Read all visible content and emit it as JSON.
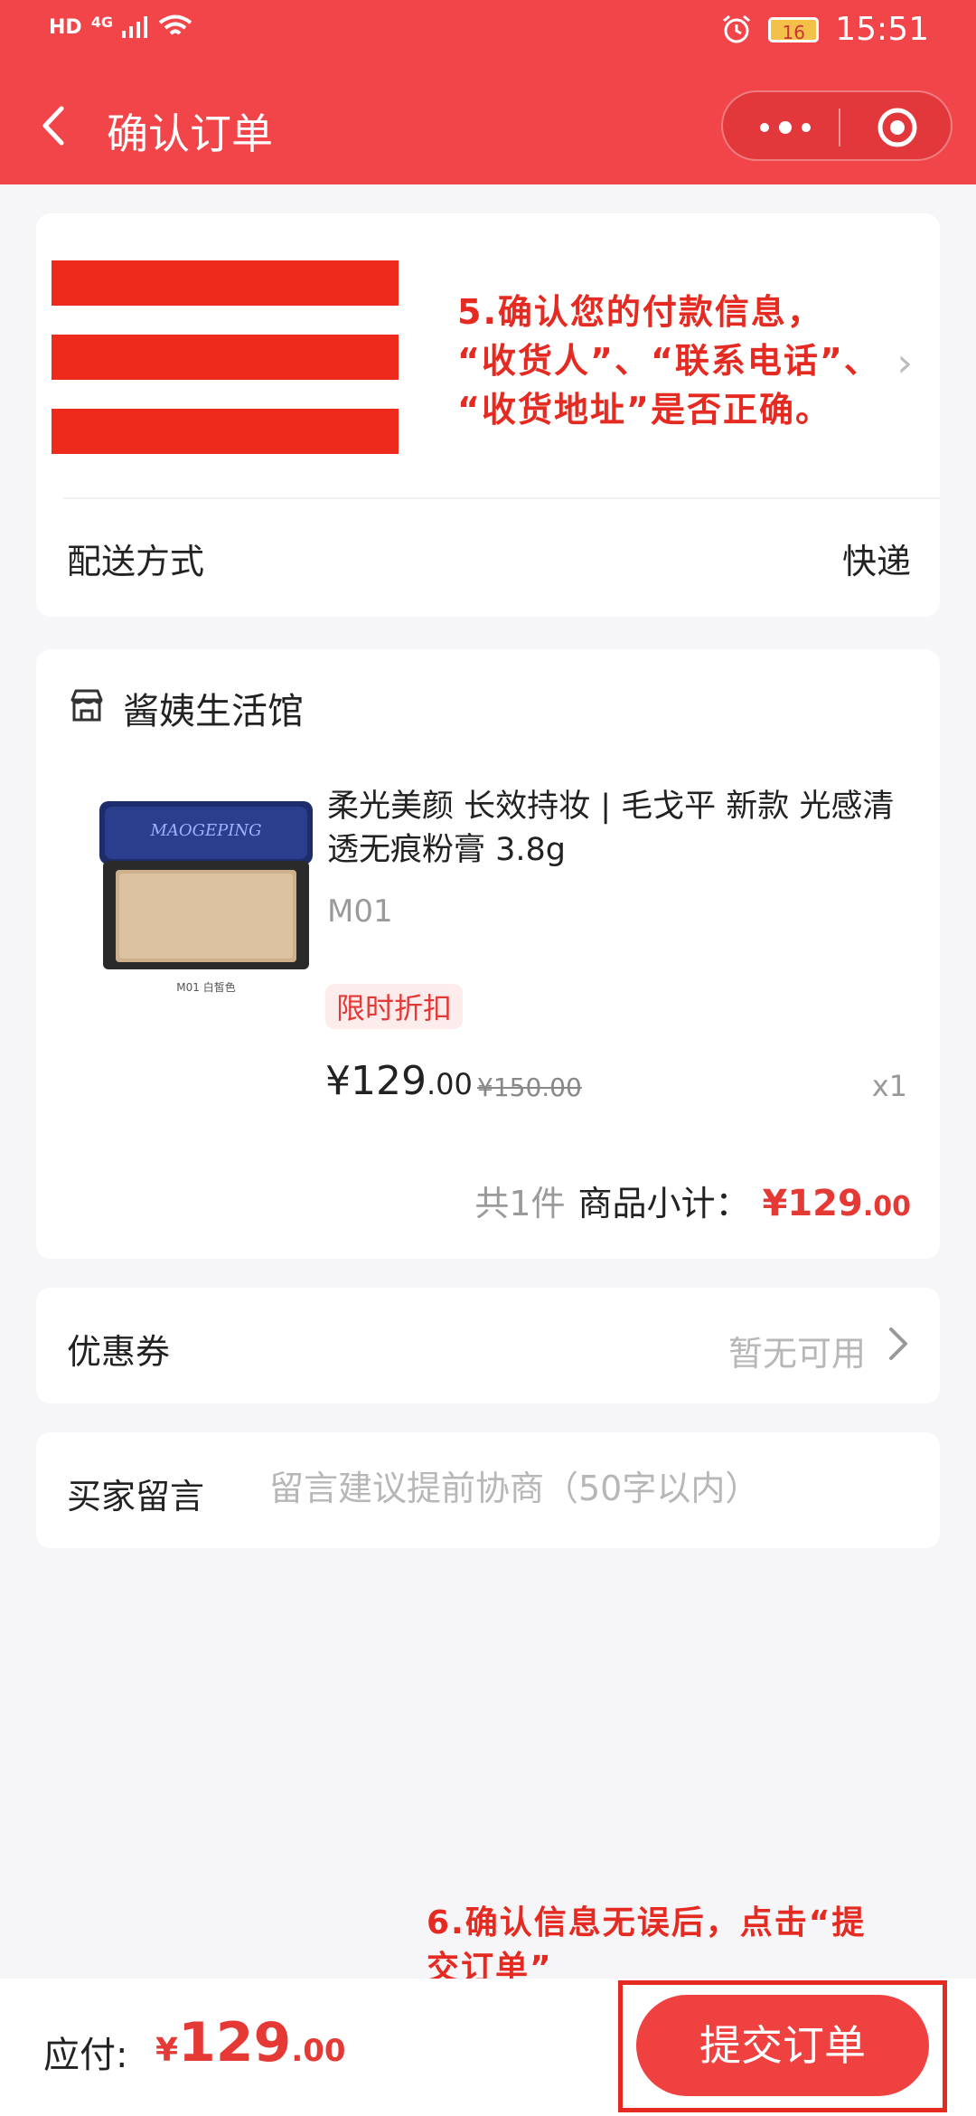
{
  "status": {
    "left": [
      "HD",
      "4G",
      "signal-icon",
      "wifi-icon"
    ],
    "battery": "16",
    "time": "15:51"
  },
  "nav": {
    "title": "确认订单"
  },
  "address": {
    "annotation_lines": [
      "5.确认您的付款信息，",
      "“收货人”、“联系电话”、",
      "“收货地址”是否正确。"
    ]
  },
  "delivery": {
    "label": "配送方式",
    "value": "快递"
  },
  "shop": {
    "name": "酱姨生活馆"
  },
  "product": {
    "title": "柔光美颜 长效持妆 | 毛戈平 新款 光感清透无痕粉膏 3.8g",
    "spec": "M01",
    "promo": "限时折扣",
    "price_int": "¥129",
    "price_dec": ".00",
    "orig_price": "¥150.00",
    "qty": "x1",
    "box_brand": "MAOGEPING",
    "shade_label": "M01 白皙色"
  },
  "summary": {
    "count": "共1件",
    "label": "商品小计：",
    "price_int": "¥129",
    "price_dec": ".00"
  },
  "coupon": {
    "label": "优惠券",
    "value": "暂无可用"
  },
  "message": {
    "label": "买家留言",
    "placeholder": "留言建议提前协商（50字以内）"
  },
  "footer": {
    "pay_label": "应付:",
    "pay_symbol": "¥",
    "pay_int": "129",
    "pay_dec": ".00",
    "submit_label": "提交订单",
    "annotation_lines": [
      "6.确认信息无误后，点击“提",
      "交订单”"
    ]
  },
  "colors": {
    "accent": "#f2454a",
    "price": "#e53935",
    "annotation": "#e52a22"
  }
}
